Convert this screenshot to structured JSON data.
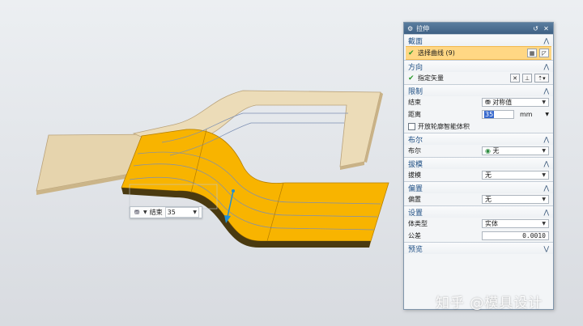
{
  "floating_input": {
    "label": "结束",
    "value": "35"
  },
  "dialog": {
    "title": "拉伸",
    "sections": {
      "section_profile": {
        "title": "截面",
        "select_curve": "选择曲线 (9)"
      },
      "section_direction": {
        "title": "方向",
        "specify_vector": "指定矢量"
      },
      "section_limits": {
        "title": "限制",
        "end_label": "结束",
        "end_value": "对称值",
        "distance_label": "距离",
        "distance_value": "35",
        "distance_unit": "mm",
        "open_profile_label": "开放轮廓智能体积"
      },
      "section_boolean": {
        "title": "布尔",
        "boolean_label": "布尔",
        "boolean_value": "无"
      },
      "section_draft": {
        "title": "拔模",
        "draft_label": "拔模",
        "draft_value": "无"
      },
      "section_offset": {
        "title": "偏置",
        "offset_label": "偏置",
        "offset_value": "无"
      },
      "section_settings": {
        "title": "设置",
        "body_type_label": "体类型",
        "body_type_value": "实体",
        "tolerance_label": "公差",
        "tolerance_value": "0.0010"
      },
      "section_preview": {
        "title": "预览"
      }
    }
  },
  "watermark": "知乎 @模具设计",
  "colors": {
    "accent_title": "#3f6184",
    "selection_highlight": "#ffd784",
    "extrude_preview": "#f8b400",
    "sheet": "#e8d7b0"
  },
  "icons": {
    "title_icon": "gear-icon",
    "reset_icon": "reset-icon",
    "close_icon": "close-icon",
    "curve_icon": "curve-icon",
    "sketch_icon": "sketch-icon",
    "vector_icon": "vector-icon"
  }
}
